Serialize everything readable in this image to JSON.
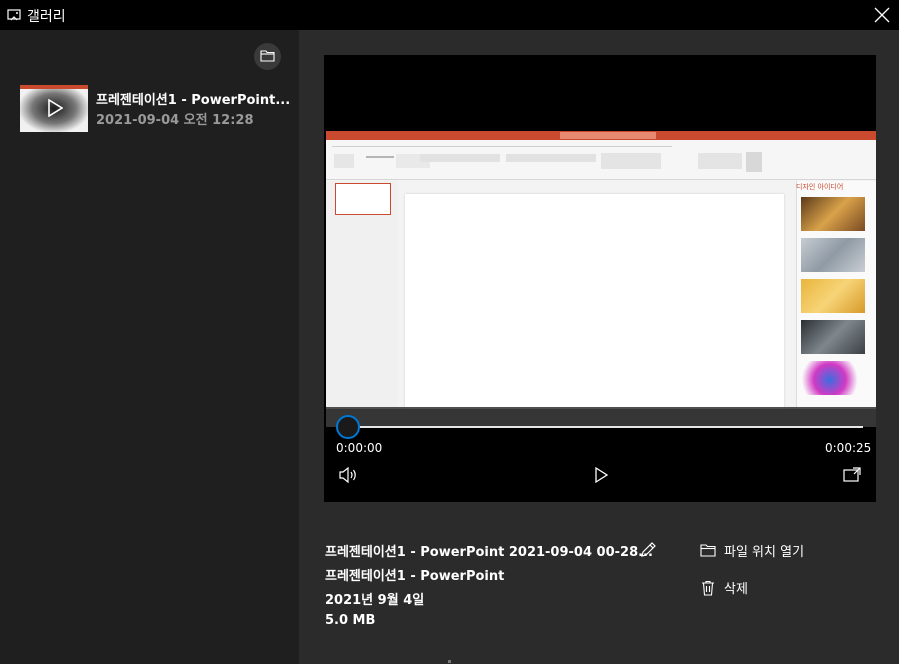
{
  "window": {
    "title": "갤러리"
  },
  "sidebar": {
    "items": [
      {
        "title": "프레젠테이션1 - PowerPoint...",
        "date": "2021-09-04 오전 12:28"
      }
    ]
  },
  "player": {
    "current_time": "0:00:00",
    "duration": "0:00:25",
    "progress": 0
  },
  "video_frame": {
    "designer_panel_title": "디자인 아이디어"
  },
  "details": {
    "file_name": "프레젠테이션1 - PowerPoint 2021-09-04 00-28...",
    "app_name": "프레젠테이션1 - PowerPoint",
    "date": "2021년 9월 4일",
    "size": "5.0 MB"
  },
  "actions": {
    "open_location": "파일 위치 열기",
    "delete": "삭제"
  },
  "colors": {
    "accent": "#0078d4",
    "powerpoint": "#c94a2f",
    "background": "#1f1f1f",
    "panel": "#2b2b2b"
  },
  "icons": [
    "gallery-icon",
    "close-icon",
    "folder-icon",
    "play-icon",
    "volume-icon",
    "pip-icon",
    "edit-icon",
    "trash-icon"
  ]
}
